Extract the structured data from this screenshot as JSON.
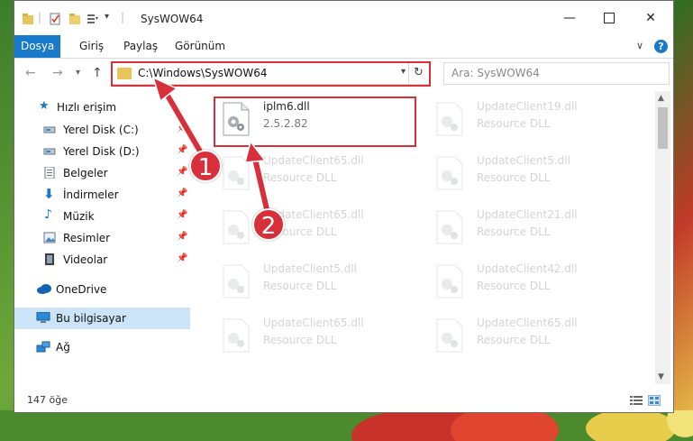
{
  "window": {
    "title": "SysWOW64",
    "accent": "#1979ca"
  },
  "ribbon": {
    "tabs": [
      {
        "label": "Dosya",
        "active": true
      },
      {
        "label": "Giriş"
      },
      {
        "label": "Paylaş"
      },
      {
        "label": "Görünüm"
      }
    ]
  },
  "address": {
    "path": "C:\\Windows\\SysWOW64",
    "search_placeholder": "Ara: SysWOW64"
  },
  "sidebar": {
    "items": [
      {
        "label": "Hızlı erişim",
        "icon": "star-icon"
      },
      {
        "label": "Yerel Disk (C:)",
        "icon": "drive-icon"
      },
      {
        "label": "Yerel Disk (D:)",
        "icon": "drive-icon"
      },
      {
        "label": "Belgeler",
        "icon": "documents-icon"
      },
      {
        "label": "İndirmeler",
        "icon": "download-icon"
      },
      {
        "label": "Müzik",
        "icon": "music-icon"
      },
      {
        "label": "Resimler",
        "icon": "pictures-icon"
      },
      {
        "label": "Videolar",
        "icon": "video-icon"
      },
      {
        "label": "OneDrive",
        "icon": "cloud-icon"
      },
      {
        "label": "Bu bilgisayar",
        "icon": "computer-icon"
      },
      {
        "label": "Ağ",
        "icon": "network-icon"
      }
    ]
  },
  "files": [
    {
      "name": "iplm6.dll",
      "desc": "2.5.2.82"
    },
    {
      "name": "UpdateClient19.dll",
      "desc": "Resource DLL"
    },
    {
      "name": "UpdateClient65.dll",
      "desc": "Resource DLL"
    },
    {
      "name": "UpdateClient5.dll",
      "desc": "Resource DLL"
    },
    {
      "name": "UpdateClient65.dll",
      "desc": "Resource DLL"
    },
    {
      "name": "UpdateClient21.dll",
      "desc": "Resource DLL"
    },
    {
      "name": "UpdateClient5.dll",
      "desc": "Resource DLL"
    },
    {
      "name": "UpdateClient42.dll",
      "desc": "Resource DLL"
    },
    {
      "name": "UpdateClient65.dll",
      "desc": "Resource DLL"
    },
    {
      "name": "UpdateClient65.dll",
      "desc": "Resource DLL"
    }
  ],
  "status": {
    "count": "147 öğe"
  },
  "annotations": {
    "step1": "1",
    "step2": "2",
    "color": "#d8303a"
  }
}
